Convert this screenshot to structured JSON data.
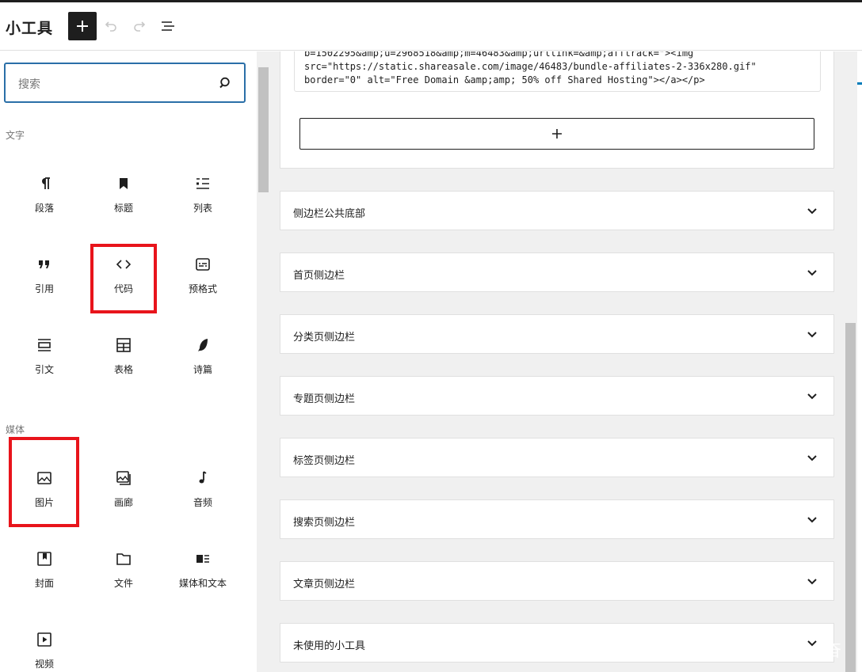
{
  "header": {
    "title": "小工具"
  },
  "sidebar": {
    "search_placeholder": "搜索",
    "categories": {
      "text": "文字",
      "media": "媒体"
    },
    "blocks": {
      "paragraph": "段落",
      "heading": "标题",
      "list": "列表",
      "quote": "引用",
      "code": "代码",
      "preformatted": "预格式",
      "pullquote": "引文",
      "table": "表格",
      "verse": "诗篇",
      "image": "图片",
      "gallery": "画廊",
      "audio": "音频",
      "cover": "封面",
      "file": "文件",
      "media_text": "媒体和文本",
      "video": "视频"
    }
  },
  "editor": {
    "code_lines": [
      "b=1502295&amp;u=2968518&amp;m=46483&amp;urllink=&amp;afftrack=\"><img",
      "src=\"https://static.shareasale.com/image/46483/bundle-affiliates-2-336x280.gif\"",
      "border=\"0\" alt=\"Free Domain &amp;amp; 50% off Shared Hosting\"></a></p>"
    ],
    "panels": [
      "侧边栏公共底部",
      "首页侧边栏",
      "分类页侧边栏",
      "专题页侧边栏",
      "标签页侧边栏",
      "搜索页侧边栏",
      "文章页侧边栏",
      "未使用的小工具"
    ]
  },
  "watermark": "奋",
  "colors": {
    "highlight": "#e8141b",
    "focus": "#2a6fa8",
    "accent": "#007cba"
  }
}
